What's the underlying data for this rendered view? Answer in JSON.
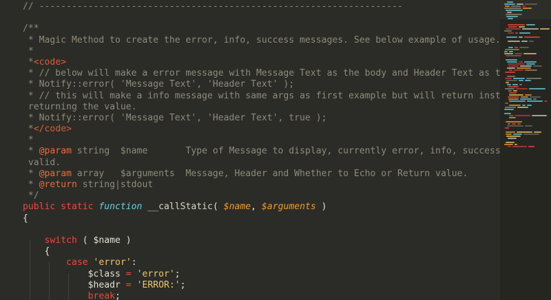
{
  "editor": {
    "lines": [
      [
        {
          "t": "// -------------------------------------------------------------------",
          "c": "com"
        }
      ],
      [],
      [
        {
          "t": "/**",
          "c": "com"
        }
      ],
      [
        {
          "t": " * Magic Method to create the error, info, success messages. See below example of usage.",
          "c": "com"
        }
      ],
      [
        {
          "t": " *",
          "c": "com"
        }
      ],
      [
        {
          "t": " *",
          "c": "com"
        },
        {
          "t": "<code>",
          "c": "tag"
        }
      ],
      [
        {
          "t": " * // below will make a error message with Message Text as the body and Header Text as the Header.",
          "c": "com"
        }
      ],
      [
        {
          "t": " * Notify::error( 'Message Text', 'Header Text' );",
          "c": "com"
        }
      ],
      [
        {
          "t": " * // this will make a info message with same args as first example but will return instead of",
          "c": "com"
        }
      ],
      [
        {
          "t": " returning the value.",
          "c": "com"
        }
      ],
      [
        {
          "t": " * Notify::error( 'Message Text', 'Header Text', true );",
          "c": "com"
        }
      ],
      [
        {
          "t": " *",
          "c": "com"
        },
        {
          "t": "</code>",
          "c": "tag"
        }
      ],
      [
        {
          "t": " *",
          "c": "com"
        }
      ],
      [
        {
          "t": " * ",
          "c": "com"
        },
        {
          "t": "@param",
          "c": "par"
        },
        {
          "t": " string  $name       Type of Message to display, currently error, info, success are all",
          "c": "com"
        }
      ],
      [
        {
          "t": " valid.",
          "c": "com"
        }
      ],
      [
        {
          "t": " * ",
          "c": "com"
        },
        {
          "t": "@param",
          "c": "par"
        },
        {
          "t": " array   $arguments  Message, Header and Whether to Echo or Return value.",
          "c": "com"
        }
      ],
      [
        {
          "t": " * ",
          "c": "com"
        },
        {
          "t": "@return",
          "c": "par"
        },
        {
          "t": " string|stdout",
          "c": "com"
        }
      ],
      [
        {
          "t": " */",
          "c": "com"
        }
      ],
      [
        {
          "t": "public static ",
          "c": "kw"
        },
        {
          "t": "function",
          "c": "fn"
        },
        {
          "t": " __callStatic",
          "c": "nm"
        },
        {
          "t": "( ",
          "c": "pl"
        },
        {
          "t": "$name",
          "c": "var"
        },
        {
          "t": ", ",
          "c": "pl"
        },
        {
          "t": "$arguments",
          "c": "var"
        },
        {
          "t": " )",
          "c": "pl"
        }
      ],
      [
        {
          "t": "{",
          "c": "pl"
        }
      ],
      [],
      [
        {
          "t": "    ",
          "c": "pl"
        },
        {
          "t": "switch",
          "c": "kw"
        },
        {
          "t": " ( $name )",
          "c": "pl"
        }
      ],
      [
        {
          "t": "    {",
          "c": "pl"
        }
      ],
      [
        {
          "t": "        ",
          "c": "pl"
        },
        {
          "t": "case",
          "c": "kw"
        },
        {
          "t": " ",
          "c": "pl"
        },
        {
          "t": "'error'",
          "c": "str"
        },
        {
          "t": ":",
          "c": "pl"
        }
      ],
      [
        {
          "t": "            $class ",
          "c": "pl"
        },
        {
          "t": "=",
          "c": "kw"
        },
        {
          "t": " ",
          "c": "pl"
        },
        {
          "t": "'error'",
          "c": "str"
        },
        {
          "t": ";",
          "c": "pl"
        }
      ],
      [
        {
          "t": "            $headr ",
          "c": "pl"
        },
        {
          "t": "=",
          "c": "kw"
        },
        {
          "t": " ",
          "c": "pl"
        },
        {
          "t": "'ERROR:'",
          "c": "str"
        },
        {
          "t": ";",
          "c": "pl"
        }
      ],
      [
        {
          "t": "            ",
          "c": "pl"
        },
        {
          "t": "break",
          "c": "kw"
        },
        {
          "t": ";",
          "c": "pl"
        }
      ]
    ]
  },
  "theme": {
    "background": "#2b2c27",
    "comment": "#8f8b7b",
    "keyword": "#f0473c",
    "function_keyword": "#66cfe3",
    "variable": "#f59a2c",
    "string": "#f0c66f"
  }
}
